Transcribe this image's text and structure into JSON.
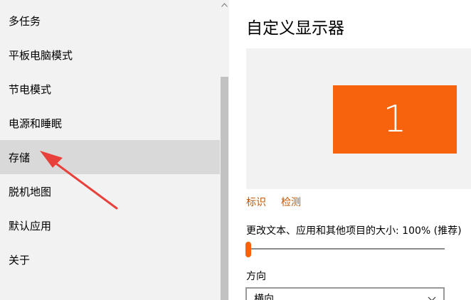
{
  "sidebar": {
    "items": [
      {
        "label": "多任务"
      },
      {
        "label": "平板电脑模式"
      },
      {
        "label": "节电模式"
      },
      {
        "label": "电源和睡眠"
      },
      {
        "label": "存储",
        "selected": true
      },
      {
        "label": "脱机地图"
      },
      {
        "label": "默认应用"
      },
      {
        "label": "关于"
      }
    ]
  },
  "main": {
    "title": "自定义显示器",
    "monitor_number": "1",
    "identify_link": "标识",
    "detect_link": "检测",
    "scale_label": "更改文本、应用和其他项目的大小: 100% (推荐)",
    "scale_value_percent": 0,
    "orientation_label": "方向",
    "orientation_value": "横向"
  },
  "colors": {
    "accent": "#f7630c",
    "link": "#c45500",
    "sidebar_bg": "#f2f2f2",
    "selected_bg": "#d9d9d9",
    "annotation_arrow": "#e8403a"
  }
}
